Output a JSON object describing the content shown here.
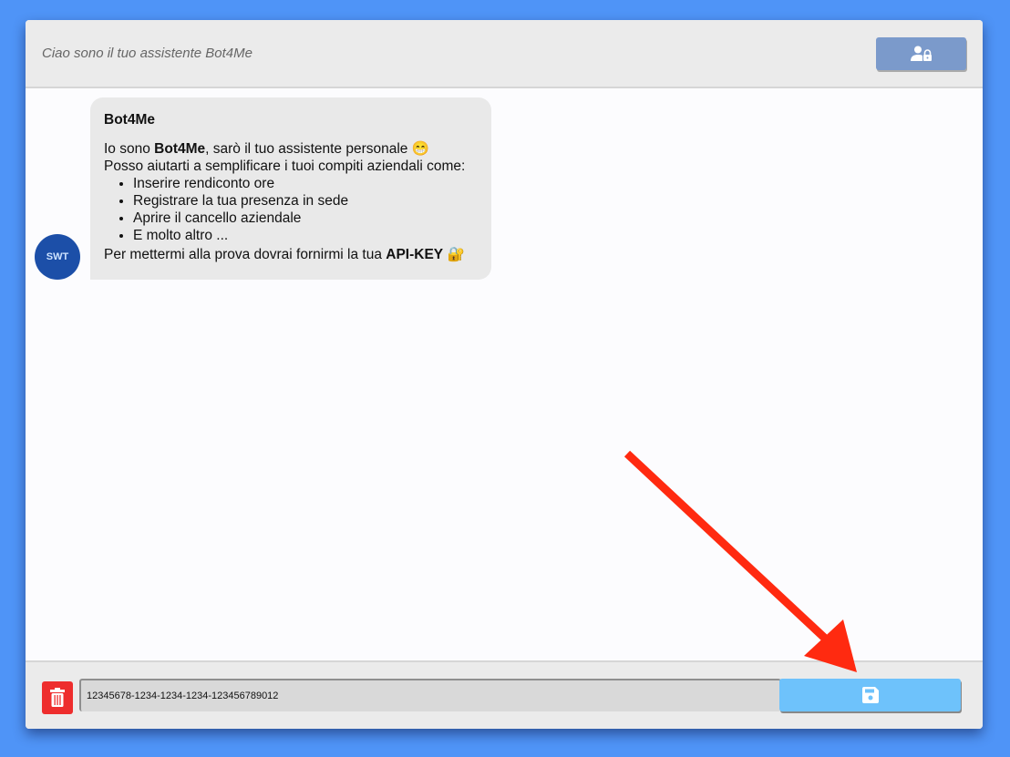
{
  "header": {
    "title": "Ciao sono il tuo assistente Bot4Me",
    "apikey_icon": "user-lock-icon"
  },
  "chat": {
    "avatar_text": "SWT",
    "message": {
      "sender": "Bot4Me",
      "line1_pre": "Io sono ",
      "line1_bold": "Bot4Me",
      "line1_post": ", sarò il tuo assistente personale 😁",
      "line2": "Posso aiutarti a semplificare i tuoi compiti aziendali come:",
      "items": [
        "Inserire rendiconto ore",
        "Registrare la tua presenza in sede",
        "Aprire il cancello aziendale",
        "E molto altro ..."
      ],
      "last_pre": "Per mettermi alla prova dovrai fornirmi la tua ",
      "last_bold": "API-KEY",
      "last_emoji": " 🔐"
    }
  },
  "footer": {
    "api_key_value": "12345678-1234-1234-1234-123456789012",
    "delete_icon": "trash-icon",
    "save_icon": "floppy-disk-icon"
  },
  "colors": {
    "background": "#4f94f7",
    "save": "#6ec2fb",
    "delete": "#ee2d2d",
    "apikey_button": "#7b9acb",
    "arrow": "#ff2a10"
  }
}
